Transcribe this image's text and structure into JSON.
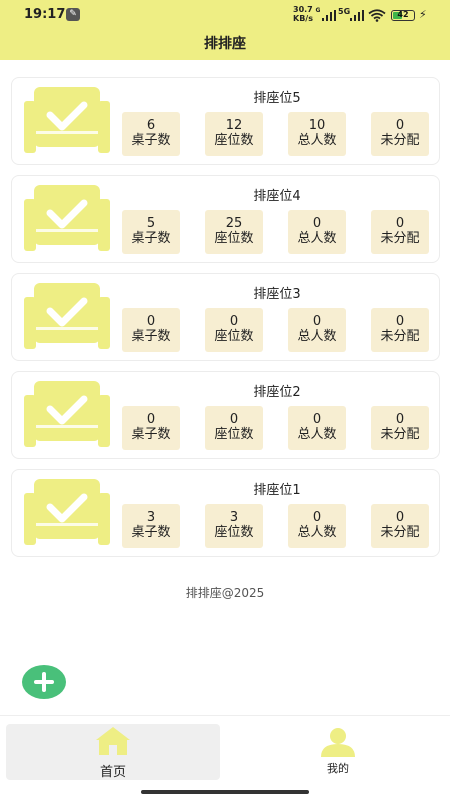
{
  "status_bar": {
    "time": "19:17",
    "speed_top": "30.7",
    "speed_unit_g": "G",
    "speed_bottom": "KB/s",
    "network": "5G",
    "battery": "42",
    "battery_level": 0.42
  },
  "header": {
    "title": "排排座"
  },
  "colors": {
    "accent": "#eeee84",
    "stat_bg": "#f7eed2",
    "fab": "#49c07a"
  },
  "cards": [
    {
      "title": "排座位5",
      "stats": [
        {
          "value": "6",
          "label": "桌子数"
        },
        {
          "value": "12",
          "label": "座位数"
        },
        {
          "value": "10",
          "label": "总人数"
        },
        {
          "value": "0",
          "label": "未分配"
        }
      ]
    },
    {
      "title": "排座位4",
      "stats": [
        {
          "value": "5",
          "label": "桌子数"
        },
        {
          "value": "25",
          "label": "座位数"
        },
        {
          "value": "0",
          "label": "总人数"
        },
        {
          "value": "0",
          "label": "未分配"
        }
      ]
    },
    {
      "title": "排座位3",
      "stats": [
        {
          "value": "0",
          "label": "桌子数"
        },
        {
          "value": "0",
          "label": "座位数"
        },
        {
          "value": "0",
          "label": "总人数"
        },
        {
          "value": "0",
          "label": "未分配"
        }
      ]
    },
    {
      "title": "排座位2",
      "stats": [
        {
          "value": "0",
          "label": "桌子数"
        },
        {
          "value": "0",
          "label": "座位数"
        },
        {
          "value": "0",
          "label": "总人数"
        },
        {
          "value": "0",
          "label": "未分配"
        }
      ]
    },
    {
      "title": "排座位1",
      "stats": [
        {
          "value": "3",
          "label": "桌子数"
        },
        {
          "value": "3",
          "label": "座位数"
        },
        {
          "value": "0",
          "label": "总人数"
        },
        {
          "value": "0",
          "label": "未分配"
        }
      ]
    }
  ],
  "footer": {
    "copyright": "排排座@2025"
  },
  "fab": {
    "icon": "plus-icon"
  },
  "tabbar": {
    "home": {
      "label": "首页",
      "icon": "home-icon"
    },
    "mine": {
      "label": "我的",
      "icon": "user-icon"
    }
  }
}
